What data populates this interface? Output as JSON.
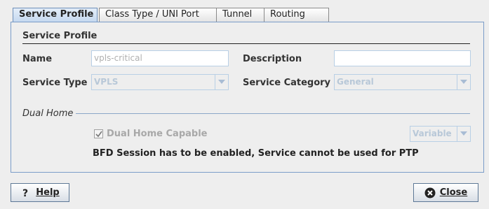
{
  "tabs": [
    {
      "label": "Service Profile",
      "active": true
    },
    {
      "label": "Class Type / UNI Port",
      "active": false
    },
    {
      "label": "Tunnel",
      "active": false
    },
    {
      "label": "Routing",
      "active": false
    }
  ],
  "section": {
    "title": "Service Profile"
  },
  "form": {
    "name_label": "Name",
    "name_value": "vpls-critical",
    "description_label": "Description",
    "description_value": "",
    "service_type_label": "Service Type",
    "service_type_value": "VPLS",
    "service_category_label": "Service Category",
    "service_category_value": "General"
  },
  "dual_home": {
    "title": "Dual Home",
    "capable_label": "Dual Home Capable",
    "capable_checked": true,
    "mode_value": "Variable"
  },
  "note": "BFD Session has to be enabled, Service cannot be used for PTP",
  "buttons": {
    "help_label": "Help",
    "close_label": "Close"
  },
  "colors": {
    "active_tab": "#c5d8ef",
    "panel_border": "#7a9cc8",
    "close_icon": "#222222"
  }
}
